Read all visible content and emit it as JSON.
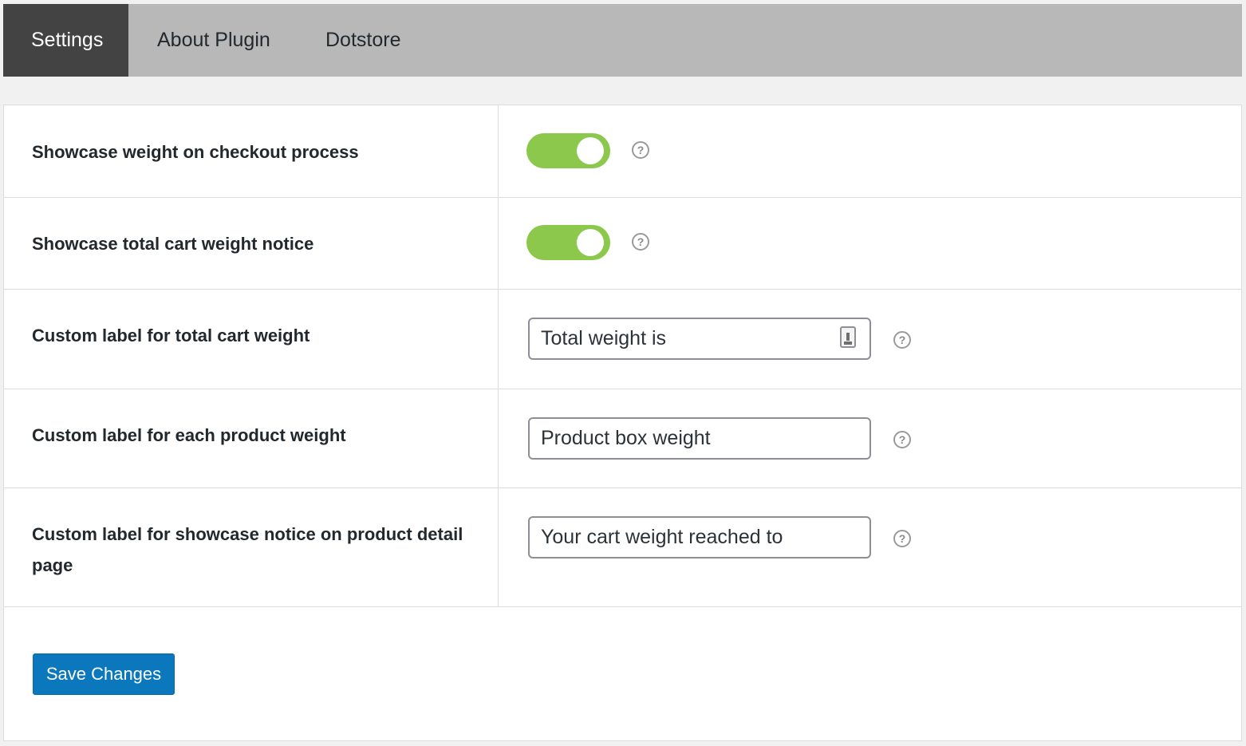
{
  "tabs": [
    {
      "label": "Settings",
      "active": true
    },
    {
      "label": "About Plugin",
      "active": false
    },
    {
      "label": "Dotstore",
      "active": false
    }
  ],
  "settings": [
    {
      "label": "Showcase weight on checkout process",
      "control": "toggle",
      "enabled": true
    },
    {
      "label": "Showcase total cart weight notice",
      "control": "toggle",
      "enabled": true
    },
    {
      "label": "Custom label for total cart weight",
      "control": "text",
      "value": "Total weight is"
    },
    {
      "label": "Custom label for each product weight",
      "control": "text",
      "value": "Product box weight"
    },
    {
      "label": "Custom label for showcase notice on product detail page",
      "control": "text",
      "value": "Your cart weight reached to"
    }
  ],
  "help_glyph": "?",
  "save_label": "Save Changes",
  "colors": {
    "tab_bar": "#b8b8b8",
    "tab_active": "#434343",
    "toggle_on": "#8cc84b",
    "primary_button": "#0b78be"
  },
  "icons": {
    "help": "help-circle-icon",
    "autofill": "autofill-contact-icon"
  }
}
